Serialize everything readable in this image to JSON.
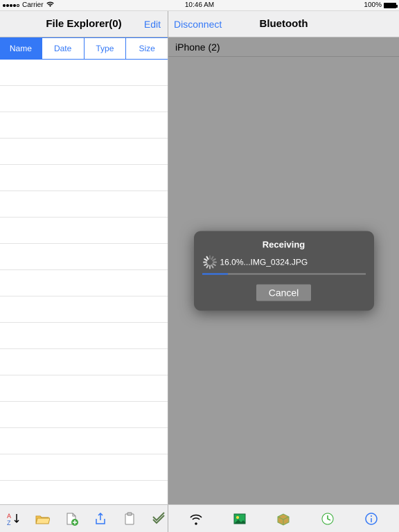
{
  "status": {
    "carrier": "Carrier",
    "wifi_icon": "wifi-icon",
    "time": "10:46 AM",
    "battery_pct": "100%"
  },
  "left": {
    "title": "File Explorer(0)",
    "edit": "Edit",
    "tabs": [
      {
        "label": "Name",
        "active": true
      },
      {
        "label": "Date",
        "active": false
      },
      {
        "label": "Type",
        "active": false
      },
      {
        "label": "Size",
        "active": false
      }
    ],
    "row_count": 17
  },
  "right": {
    "disconnect": "Disconnect",
    "title": "Bluetooth",
    "device_header": "iPhone (2)"
  },
  "modal": {
    "title": "Receiving",
    "percent_text": "16.0%...IMG_0324.JPG",
    "progress_pct": 16,
    "cancel": "Cancel"
  },
  "toolbar_left_icons": [
    "sort-az-icon",
    "open-folder-icon",
    "new-file-icon",
    "share-icon",
    "clipboard-icon",
    "checkmark-icon"
  ],
  "toolbar_right_icons": [
    "wifi-toolbar-icon",
    "photo-icon",
    "box-icon",
    "clock-icon",
    "info-icon"
  ],
  "colors": {
    "ios_blue": "#3478f6"
  }
}
